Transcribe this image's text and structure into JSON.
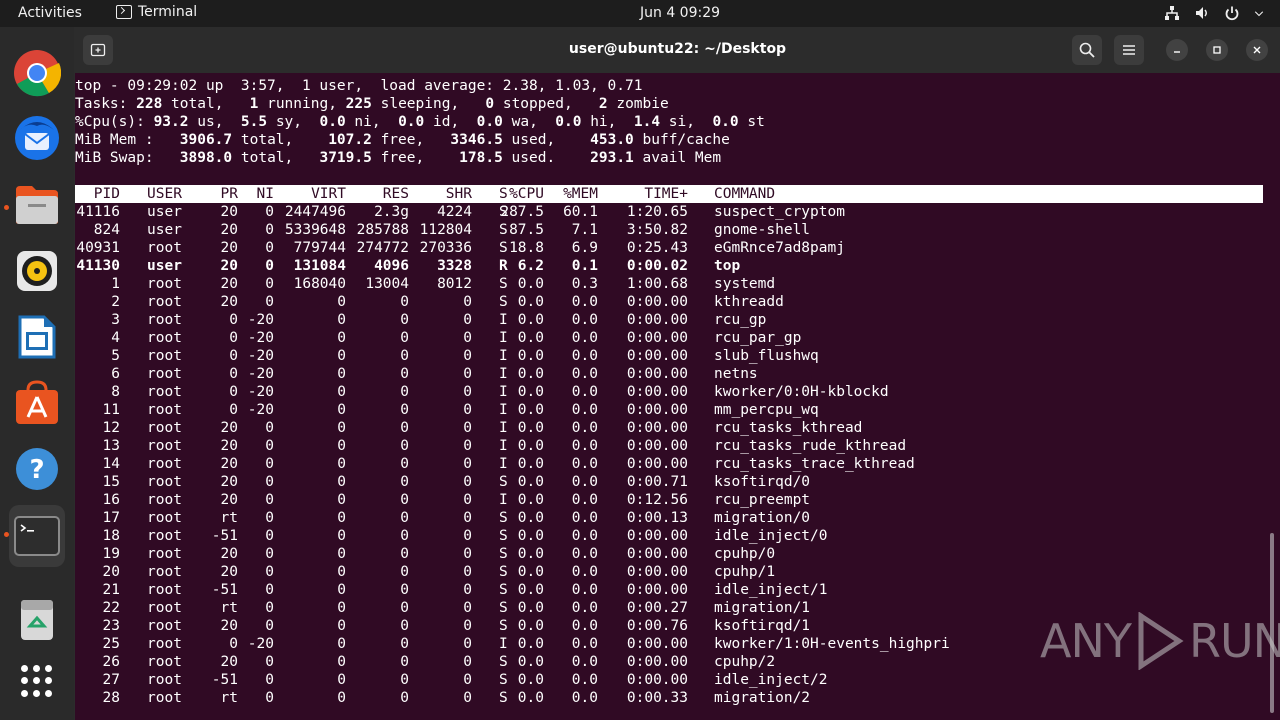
{
  "topbar": {
    "activities": "Activities",
    "app_name": "Terminal",
    "clock": "Jun 4  09:29"
  },
  "dock": {
    "items": [
      "chrome-icon",
      "thunderbird-icon",
      "files-icon",
      "rhythmbox-icon",
      "writer-icon",
      "app-center-icon",
      "help-icon",
      "terminal-icon",
      "trash-icon"
    ]
  },
  "window": {
    "title": "user@ubuntu22: ~/Desktop"
  },
  "top": {
    "summary": [
      "top - 09:29:02 up  3:57,  1 user,  load average: 2.38, 1.03, 0.71",
      "Tasks: 228 total,   1 running, 225 sleeping,   0 stopped,   2 zombie",
      "%Cpu(s): 93.2 us,  5.5 sy,  0.0 ni,  0.0 id,  0.0 wa,  0.0 hi,  1.4 si,  0.0 st",
      "MiB Mem :   3906.7 total,    107.2 free,   3346.5 used,    453.0 buff/cache",
      "MiB Swap:   3898.0 total,   3719.5 free,    178.5 used.    293.1 avail Mem"
    ],
    "columns": [
      "PID",
      "USER",
      "PR",
      "NI",
      "VIRT",
      "RES",
      "SHR",
      "S",
      "%CPU",
      "%MEM",
      "TIME+",
      "COMMAND"
    ],
    "processes": [
      [
        "41116",
        "user",
        "20",
        "0",
        "2447496",
        "2.3g",
        "4224",
        "S",
        "287.5",
        "60.1",
        "1:20.65",
        "suspect_cryptom"
      ],
      [
        "824",
        "user",
        "20",
        "0",
        "5339648",
        "285788",
        "112804",
        "S",
        "87.5",
        "7.1",
        "3:50.82",
        "gnome-shell"
      ],
      [
        "40931",
        "root",
        "20",
        "0",
        "779744",
        "274772",
        "270336",
        "S",
        "18.8",
        "6.9",
        "0:25.43",
        "eGmRnce7ad8pamj"
      ],
      [
        "41130",
        "user",
        "20",
        "0",
        "131084",
        "4096",
        "3328",
        "R",
        "6.2",
        "0.1",
        "0:00.02",
        "top"
      ],
      [
        "1",
        "root",
        "20",
        "0",
        "168040",
        "13004",
        "8012",
        "S",
        "0.0",
        "0.3",
        "1:00.68",
        "systemd"
      ],
      [
        "2",
        "root",
        "20",
        "0",
        "0",
        "0",
        "0",
        "S",
        "0.0",
        "0.0",
        "0:00.00",
        "kthreadd"
      ],
      [
        "3",
        "root",
        "0",
        "-20",
        "0",
        "0",
        "0",
        "I",
        "0.0",
        "0.0",
        "0:00.00",
        "rcu_gp"
      ],
      [
        "4",
        "root",
        "0",
        "-20",
        "0",
        "0",
        "0",
        "I",
        "0.0",
        "0.0",
        "0:00.00",
        "rcu_par_gp"
      ],
      [
        "5",
        "root",
        "0",
        "-20",
        "0",
        "0",
        "0",
        "I",
        "0.0",
        "0.0",
        "0:00.00",
        "slub_flushwq"
      ],
      [
        "6",
        "root",
        "0",
        "-20",
        "0",
        "0",
        "0",
        "I",
        "0.0",
        "0.0",
        "0:00.00",
        "netns"
      ],
      [
        "8",
        "root",
        "0",
        "-20",
        "0",
        "0",
        "0",
        "I",
        "0.0",
        "0.0",
        "0:00.00",
        "kworker/0:0H-kblockd"
      ],
      [
        "11",
        "root",
        "0",
        "-20",
        "0",
        "0",
        "0",
        "I",
        "0.0",
        "0.0",
        "0:00.00",
        "mm_percpu_wq"
      ],
      [
        "12",
        "root",
        "20",
        "0",
        "0",
        "0",
        "0",
        "I",
        "0.0",
        "0.0",
        "0:00.00",
        "rcu_tasks_kthread"
      ],
      [
        "13",
        "root",
        "20",
        "0",
        "0",
        "0",
        "0",
        "I",
        "0.0",
        "0.0",
        "0:00.00",
        "rcu_tasks_rude_kthread"
      ],
      [
        "14",
        "root",
        "20",
        "0",
        "0",
        "0",
        "0",
        "I",
        "0.0",
        "0.0",
        "0:00.00",
        "rcu_tasks_trace_kthread"
      ],
      [
        "15",
        "root",
        "20",
        "0",
        "0",
        "0",
        "0",
        "S",
        "0.0",
        "0.0",
        "0:00.71",
        "ksoftirqd/0"
      ],
      [
        "16",
        "root",
        "20",
        "0",
        "0",
        "0",
        "0",
        "I",
        "0.0",
        "0.0",
        "0:12.56",
        "rcu_preempt"
      ],
      [
        "17",
        "root",
        "rt",
        "0",
        "0",
        "0",
        "0",
        "S",
        "0.0",
        "0.0",
        "0:00.13",
        "migration/0"
      ],
      [
        "18",
        "root",
        "-51",
        "0",
        "0",
        "0",
        "0",
        "S",
        "0.0",
        "0.0",
        "0:00.00",
        "idle_inject/0"
      ],
      [
        "19",
        "root",
        "20",
        "0",
        "0",
        "0",
        "0",
        "S",
        "0.0",
        "0.0",
        "0:00.00",
        "cpuhp/0"
      ],
      [
        "20",
        "root",
        "20",
        "0",
        "0",
        "0",
        "0",
        "S",
        "0.0",
        "0.0",
        "0:00.00",
        "cpuhp/1"
      ],
      [
        "21",
        "root",
        "-51",
        "0",
        "0",
        "0",
        "0",
        "S",
        "0.0",
        "0.0",
        "0:00.00",
        "idle_inject/1"
      ],
      [
        "22",
        "root",
        "rt",
        "0",
        "0",
        "0",
        "0",
        "S",
        "0.0",
        "0.0",
        "0:00.27",
        "migration/1"
      ],
      [
        "23",
        "root",
        "20",
        "0",
        "0",
        "0",
        "0",
        "S",
        "0.0",
        "0.0",
        "0:00.76",
        "ksoftirqd/1"
      ],
      [
        "25",
        "root",
        "0",
        "-20",
        "0",
        "0",
        "0",
        "I",
        "0.0",
        "0.0",
        "0:00.00",
        "kworker/1:0H-events_highpri"
      ],
      [
        "26",
        "root",
        "20",
        "0",
        "0",
        "0",
        "0",
        "S",
        "0.0",
        "0.0",
        "0:00.00",
        "cpuhp/2"
      ],
      [
        "27",
        "root",
        "-51",
        "0",
        "0",
        "0",
        "0",
        "S",
        "0.0",
        "0.0",
        "0:00.00",
        "idle_inject/2"
      ],
      [
        "28",
        "root",
        "rt",
        "0",
        "0",
        "0",
        "0",
        "S",
        "0.0",
        "0.0",
        "0:00.33",
        "migration/2"
      ]
    ],
    "bold_pid": "41130"
  },
  "watermark": {
    "left": "ANY",
    "right": "RUN"
  }
}
